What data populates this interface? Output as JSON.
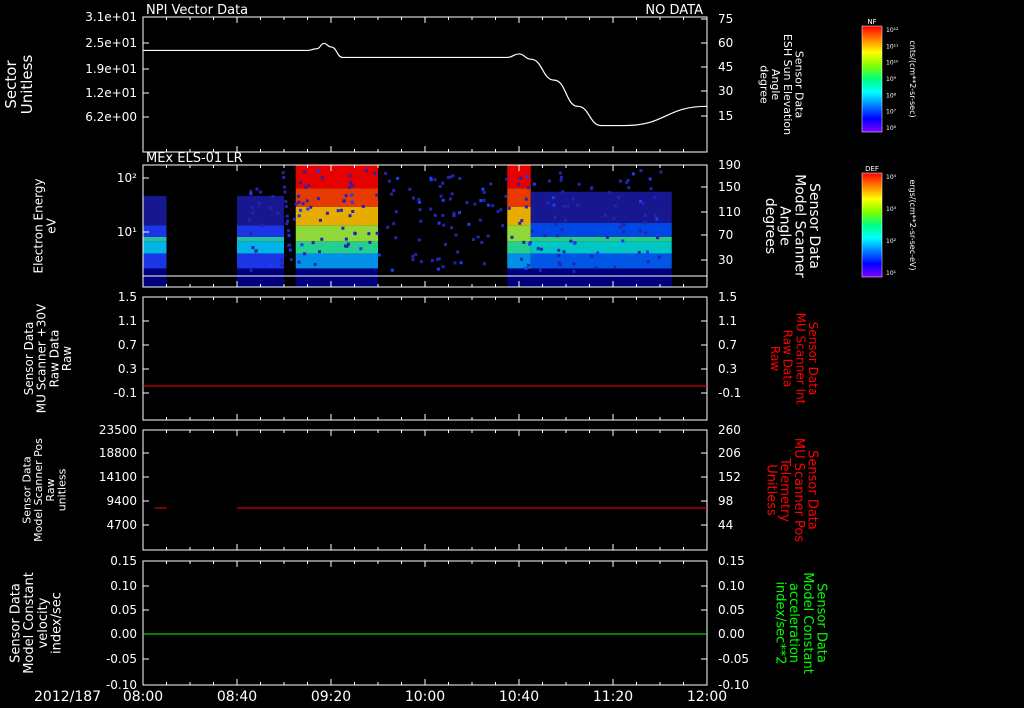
{
  "footer": {
    "date": "2012/187"
  },
  "time_axis": {
    "ticks": [
      "08:00",
      "08:40",
      "09:20",
      "10:00",
      "10:40",
      "11:20",
      "12:00"
    ]
  },
  "colors": {
    "axis": "#ffffff",
    "red": "#ff0000",
    "green": "#00ff00",
    "spectrogram_fill": "#00005a"
  },
  "colorbars": [
    {
      "label": "NF",
      "units": "cnts/(cm**2-sr-sec)",
      "ticks": [
        "10¹²",
        "10¹¹",
        "10¹⁰",
        "10⁹",
        "10⁸",
        "10⁷",
        "10⁶"
      ]
    },
    {
      "label": "DEF",
      "units": "ergs/(cm**2-sr-sec-eV)",
      "ticks": [
        "10⁴",
        "10³",
        "10²",
        "10¹"
      ]
    }
  ],
  "panels": [
    {
      "title_left": "NPI Vector Data",
      "title_right": "NO DATA",
      "left_label": [
        "Sector",
        "Unitless"
      ],
      "left_ticks": [
        "3.1e+01",
        "2.5e+01",
        "1.9e+01",
        "1.2e+01",
        "6.2e+00"
      ],
      "right_label": [
        "Sensor Data",
        "ESH Sun Elevation",
        "Angle",
        "degree"
      ],
      "right_ticks": [
        "75",
        "60",
        "45",
        "30",
        "15"
      ]
    },
    {
      "title_left": "MEx ELS-01 LR",
      "left_label": [
        "Electron Energy",
        "eV"
      ],
      "left_ticks": [
        "10²",
        "10¹"
      ],
      "right_label": [
        "Sensor Data",
        "Model Scanner",
        "Angle",
        "degrees"
      ],
      "right_ticks": [
        "190",
        "150",
        "110",
        "70",
        "30"
      ]
    },
    {
      "left_label": [
        "Sensor Data",
        "MU Scanner +30V",
        "Raw Data",
        "Raw"
      ],
      "left_ticks": [
        "1.5",
        "1.1",
        "0.7",
        "0.3",
        "-0.1"
      ],
      "right_label": [
        "Sensor Data",
        "MU Scanner Int",
        "Raw Data",
        "Raw"
      ],
      "right_ticks": [
        "1.5",
        "1.1",
        "0.7",
        "0.3",
        "-0.1"
      ]
    },
    {
      "left_label": [
        "Sensor Data",
        "Model Scanner Pos",
        "Raw",
        "unitless"
      ],
      "left_ticks": [
        "23500",
        "18800",
        "14100",
        "9400",
        "4700"
      ],
      "right_label": [
        "Sensor Data",
        "MU Scanner Pos",
        "Telemetry",
        "Unitless"
      ],
      "right_ticks": [
        "260",
        "206",
        "152",
        "98",
        "44"
      ]
    },
    {
      "left_label": [
        "Sensor Data",
        "Model Constant",
        "velocity",
        "index/sec"
      ],
      "left_ticks": [
        "0.15",
        "0.10",
        "0.05",
        "0.00",
        "-0.05",
        "-0.10"
      ],
      "right_label": [
        "Sensor Data",
        "Model Constant",
        "acceleration",
        "index/sec**2"
      ],
      "right_ticks": [
        "0.15",
        "0.10",
        "0.05",
        "0.00",
        "-0.05",
        "-0.10"
      ]
    }
  ],
  "chart_data": [
    {
      "type": "line",
      "series": [
        {
          "name": "ESH Sun Elevation Angle",
          "x": [
            "08:00",
            "09:10",
            "09:14",
            "09:17",
            "09:20",
            "09:25",
            "10:35",
            "10:40",
            "10:45",
            "10:55",
            "11:05",
            "11:15",
            "11:25",
            "12:00"
          ],
          "y": [
            57,
            57,
            58,
            61,
            59,
            53,
            53,
            55,
            52,
            40,
            25,
            14,
            14,
            25
          ]
        }
      ],
      "ylim": [
        0,
        75
      ],
      "xlim": [
        "08:00",
        "12:00"
      ]
    },
    {
      "type": "heatmap",
      "x": [
        "08:00",
        "12:00"
      ],
      "ylim": [
        2,
        190
      ],
      "values": [
        {
          "x": [
            "08:00",
            "08:10"
          ],
          "level": "low"
        },
        {
          "x": [
            "08:40",
            "09:00"
          ],
          "level": "low"
        },
        {
          "x": [
            "09:05",
            "09:40"
          ],
          "level": "high"
        },
        {
          "x": [
            "10:35",
            "10:45"
          ],
          "level": "high"
        },
        {
          "x": [
            "10:45",
            "11:45"
          ],
          "level": "mid"
        }
      ]
    },
    {
      "type": "line",
      "series": [
        {
          "name": "MU Scanner Int",
          "x": [
            "08:00",
            "12:00"
          ],
          "y": [
            0.0,
            0.0
          ]
        }
      ],
      "ylim": [
        -0.3,
        1.5
      ]
    },
    {
      "type": "line",
      "series": [
        {
          "name": "MU Scanner Pos",
          "x": [
            "08:05",
            "08:10",
            "08:40",
            "12:00"
          ],
          "y": [
            7800,
            7800,
            7800,
            7800
          ]
        }
      ],
      "ylim": [
        0,
        23500
      ]
    },
    {
      "type": "line",
      "series": [
        {
          "name": "Model Constant",
          "x": [
            "08:00",
            "12:00"
          ],
          "y": [
            0.0,
            0.0
          ]
        }
      ],
      "ylim": [
        -0.1,
        0.15
      ]
    }
  ]
}
